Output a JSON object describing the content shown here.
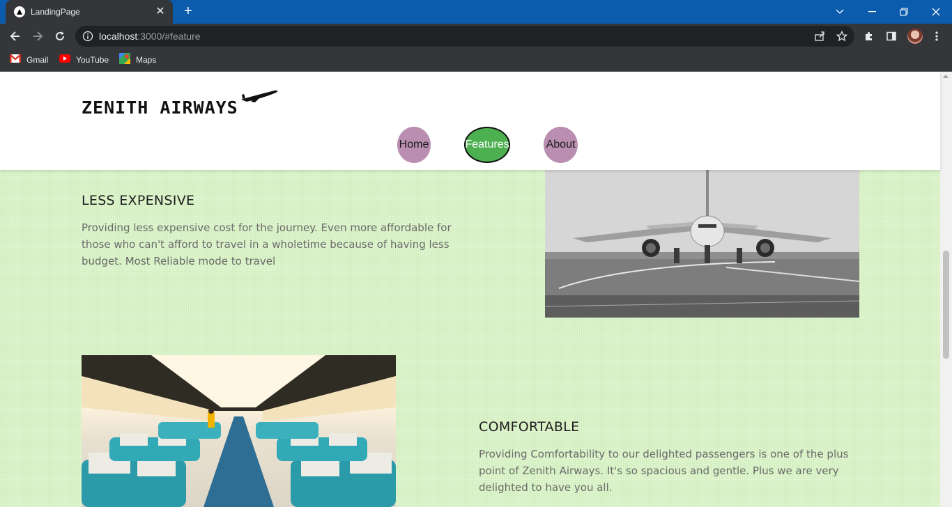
{
  "browser": {
    "tab_title": "LandingPage",
    "url_host": "localhost",
    "url_rest": ":3000/#feature",
    "bookmarks": [
      {
        "label": "Gmail",
        "icon": "gmail-icon"
      },
      {
        "label": "YouTube",
        "icon": "youtube-icon"
      },
      {
        "label": "Maps",
        "icon": "maps-icon"
      }
    ]
  },
  "site": {
    "logo": "ZENITH AIRWAYS",
    "nav": [
      {
        "label": "Home"
      },
      {
        "label": "Features",
        "active": true
      },
      {
        "label": "About"
      }
    ],
    "accent_active": "#4caf50",
    "accent_inactive": "#b98eb0",
    "content_bg": "#d9f2c6"
  },
  "features": [
    {
      "heading": "LESS EXPENSIVE",
      "text": "Providing less expensive cost for the journey. Even more affordable for those who can't afford to travel in a wholetime because of having less budget. Most Reliable mode to travel",
      "image": "airplane-on-runway-photo"
    },
    {
      "heading": "COMFORTABLE",
      "text": "Providing Comfortability to our delighted passengers is one of the plus point of Zenith Airways. It's so spacious and gentle. Plus we are very delighted to have you all.",
      "image": "aircraft-cabin-interior-photo"
    }
  ]
}
